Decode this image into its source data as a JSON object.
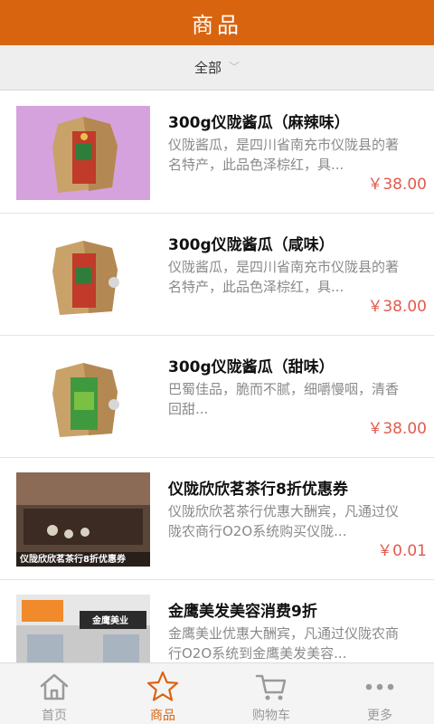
{
  "header": {
    "title": "商品"
  },
  "filter": {
    "label": "全部"
  },
  "items": [
    {
      "title": "300g仪陇酱瓜（麻辣味）",
      "desc": "仪陇酱瓜，是四川省南充市仪陇县的著名特产，此品色泽棕红，具...",
      "price": "￥38.00"
    },
    {
      "title": "300g仪陇酱瓜（咸味）",
      "desc": "仪陇酱瓜，是四川省南充市仪陇县的著名特产，此品色泽棕红，具...",
      "price": "￥38.00"
    },
    {
      "title": "300g仪陇酱瓜（甜味）",
      "desc": "巴蜀佳品，脆而不腻，细嚼慢咽，清香回甜...",
      "price": "￥38.00"
    },
    {
      "title": "仪陇欣欣茗茶行8折优惠券",
      "desc": "仪陇欣欣茗茶行优惠大酬宾，凡通过仪陇农商行O2O系统购买仪陇...",
      "price": "￥0.01",
      "image_caption": "仪陇欣欣茗茶行8折优惠券"
    },
    {
      "title": "金鹰美发美容消费9折",
      "desc": "金鹰美业优惠大酬宾，凡通过仪陇农商行O2O系统到金鹰美发美容...",
      "price": "",
      "image_caption": "金鹰美业"
    }
  ],
  "tabbar": [
    {
      "label": "首页",
      "icon": "home-icon"
    },
    {
      "label": "商品",
      "icon": "star-icon"
    },
    {
      "label": "购物车",
      "icon": "cart-icon"
    },
    {
      "label": "更多",
      "icon": "more-icon"
    }
  ],
  "colors": {
    "accent": "#d9640f",
    "price": "#e35a4e"
  }
}
